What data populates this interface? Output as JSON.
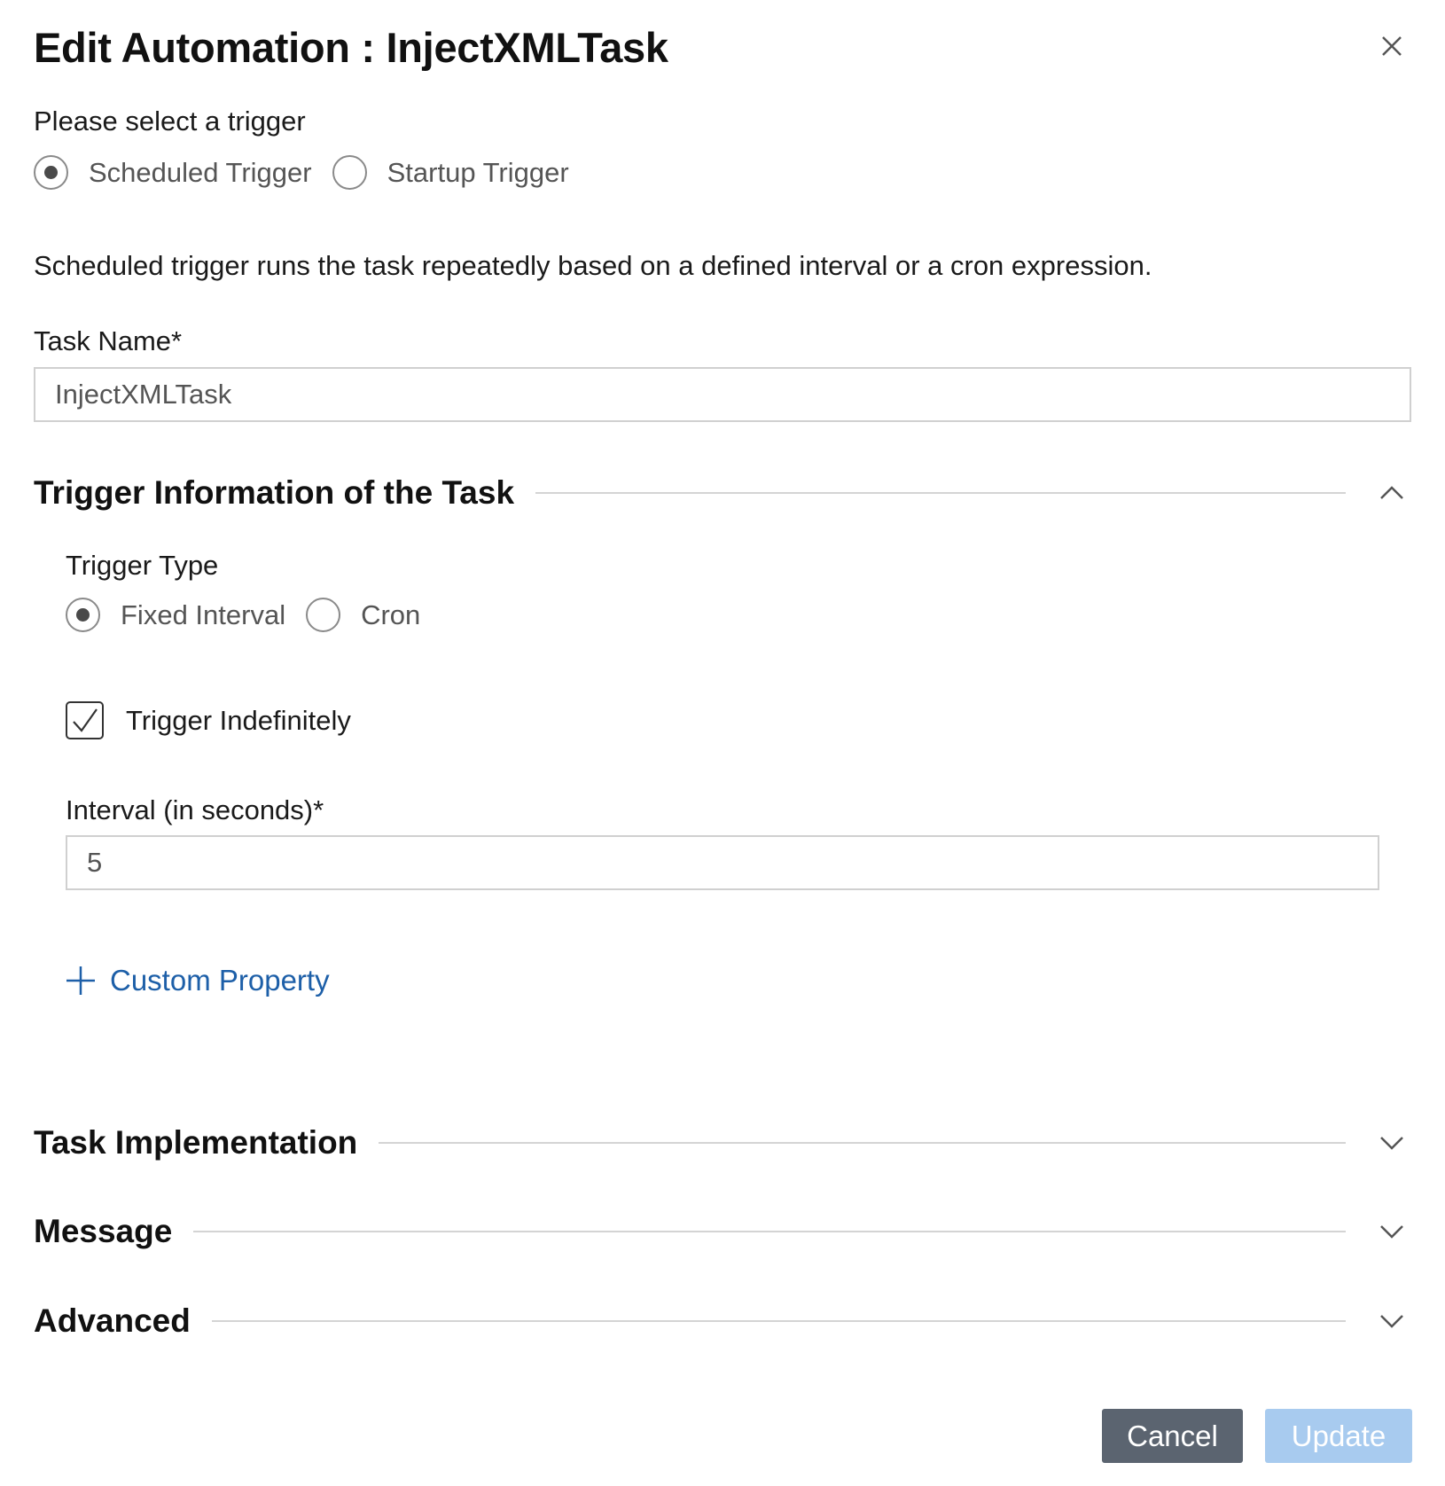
{
  "dialog": {
    "title": "Edit Automation : InjectXMLTask",
    "close_icon": "close-icon"
  },
  "trigger_select": {
    "label": "Please select a trigger",
    "options": [
      {
        "label": "Scheduled Trigger",
        "selected": true
      },
      {
        "label": "Startup Trigger",
        "selected": false
      }
    ],
    "description": "Scheduled trigger runs the task repeatedly based on a defined interval or a cron expression."
  },
  "task_name": {
    "label": "Task Name*",
    "value": "InjectXMLTask"
  },
  "sections": {
    "trigger_info": {
      "title": "Trigger Information of the Task",
      "expanded": true,
      "icon": "chevron-up-icon"
    },
    "task_impl": {
      "title": "Task Implementation",
      "expanded": false,
      "icon": "chevron-down-icon"
    },
    "message": {
      "title": "Message",
      "expanded": false,
      "icon": "chevron-down-icon"
    },
    "advanced": {
      "title": "Advanced",
      "expanded": false,
      "icon": "chevron-down-icon"
    }
  },
  "trigger_type": {
    "label": "Trigger Type",
    "options": [
      {
        "label": "Fixed Interval",
        "selected": true
      },
      {
        "label": "Cron",
        "selected": false
      }
    ]
  },
  "trigger_indefinitely": {
    "label": "Trigger Indefinitely",
    "checked": true
  },
  "interval": {
    "label": "Interval (in seconds)*",
    "value": "5"
  },
  "custom_property": {
    "label": "Custom Property",
    "icon": "plus-icon"
  },
  "footer": {
    "cancel_label": "Cancel",
    "update_label": "Update"
  },
  "colors": {
    "link": "#1d5fa8",
    "cancel_bg": "#5b6470",
    "update_bg_disabled": "#a8cbef"
  }
}
